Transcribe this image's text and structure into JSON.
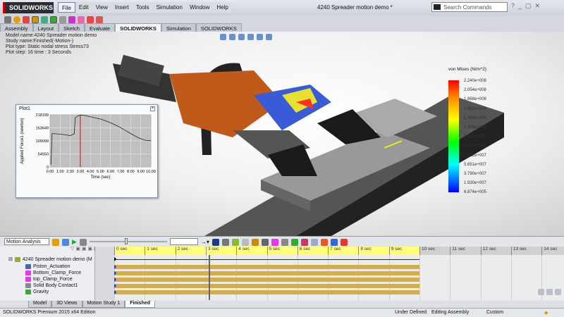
{
  "app": {
    "logo": "SOLIDWORKS",
    "document_title": "4240 Spreader motion demo *",
    "search_placeholder": "Search Commands"
  },
  "menu": [
    "File",
    "Edit",
    "View",
    "Insert",
    "Tools",
    "Simulation",
    "Window",
    "Help"
  ],
  "command_tabs": [
    "Assembly",
    "Layout",
    "Sketch",
    "Evaluate",
    "SOLIDWORKS Add-Ins",
    "Simulation",
    "SOLIDWORKS MBD"
  ],
  "active_tab": "SOLIDWORKS Add-Ins",
  "info": {
    "model": "Model name:4240 Spreader motion demo",
    "study": "Study name:Finished(-Motion-)",
    "plot_type": "Plot type: Static nodal stress Stress73",
    "plot_step": "Plot step: 16   time : 3 Seconds"
  },
  "plot": {
    "title": "Plot1"
  },
  "chart_data": {
    "type": "line",
    "title": "",
    "xlabel": "Time (sec)",
    "ylabel": "Applied Force1 (newton)",
    "xlim": [
      0,
      10
    ],
    "ylim": [
      0,
      218199
    ],
    "x_ticks": [
      "0.00",
      "1.00",
      "2.00",
      "3.00",
      "4.00",
      "5.00",
      "6.00",
      "7.00",
      "8.00",
      "9.00",
      "10.00"
    ],
    "y_ticks": [
      "0",
      "54550",
      "109099",
      "163649",
      "218199"
    ],
    "grid": true,
    "marker_time": 3.0,
    "marker_color": "#e02020",
    "x": [
      0.1,
      0.2,
      0.5,
      1.0,
      1.5,
      2.0,
      2.4,
      2.5,
      2.7,
      3.0,
      3.5,
      4.0,
      4.5,
      5.0,
      5.5,
      6.0,
      6.5,
      7.0,
      7.5,
      8.0,
      8.5,
      9.0,
      9.5,
      10.0
    ],
    "y": [
      10000,
      140000,
      139000,
      137000,
      135000,
      131000,
      139000,
      205000,
      212000,
      218000,
      215000,
      210000,
      205000,
      201000,
      193000,
      185000,
      175000,
      165000,
      152000,
      140000,
      128000,
      118000,
      111000,
      110000
    ]
  },
  "legend": {
    "title": "von Mises (N/m^2)",
    "values": [
      "2.240e+008",
      "2.054e+008",
      "1.868e+008",
      "1.682e+008",
      "1.496e+008",
      "1.309e+008",
      "1.123e+008",
      "9.373e+007",
      "7.512e+007",
      "5.651e+007",
      "3.790e+007",
      "1.930e+007",
      "6.874e+005"
    ]
  },
  "motion": {
    "study_type": "Motion Analysis",
    "tree": [
      "4240 Spreader motion demo  (M",
      "Piston_Actuation",
      "Bottom_Clamp_Force",
      "top_Clamp_Force",
      "Solid Body Contact1",
      "Gravity"
    ],
    "ticks": [
      "0 sec",
      "1 sec",
      "2 sec",
      "3 sec",
      "4 sec",
      "5 sec",
      "6 sec",
      "7 sec",
      "8 sec",
      "9 sec",
      "10 sec",
      "11 sec",
      "12 sec",
      "13 sec",
      "14 sec"
    ],
    "current_time_sec": 3,
    "end_time_sec": 10
  },
  "bottom_tabs": [
    "Model",
    "3D Views",
    "Motion Study 1",
    "Finished"
  ],
  "status": {
    "edition": "SOLIDWORKS Premium 2015 x64 Edition",
    "state": "Under Defined",
    "mode": "Editing Assembly",
    "units": "Custom"
  }
}
